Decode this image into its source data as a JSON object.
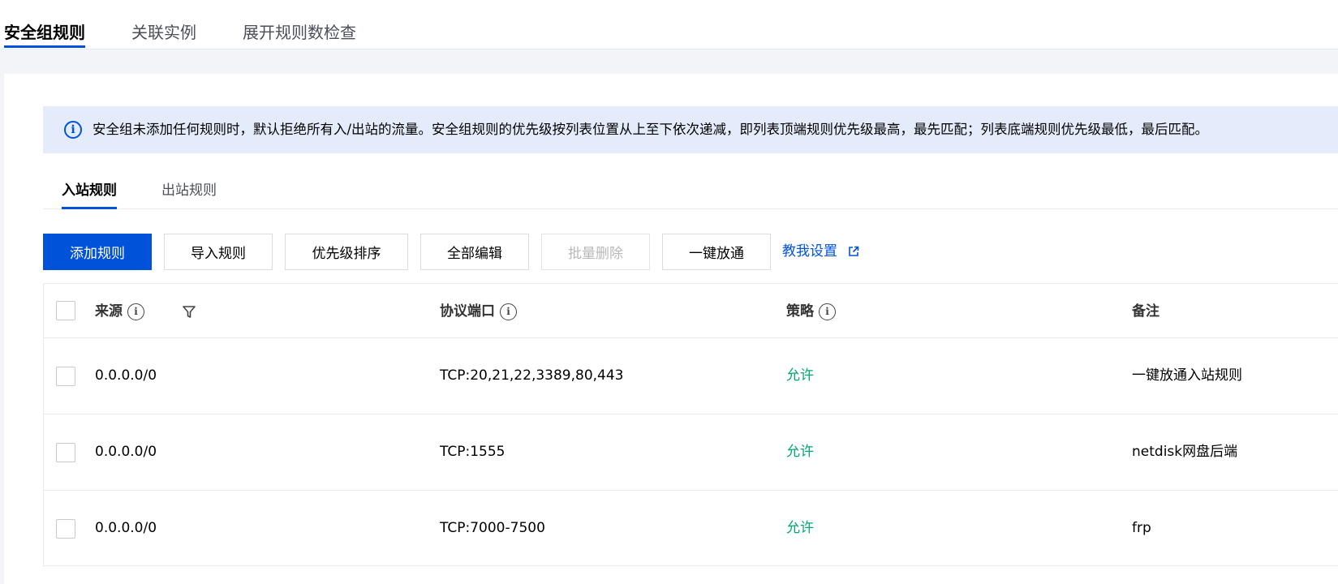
{
  "top_tabs": [
    {
      "label": "安全组规则",
      "active": true
    },
    {
      "label": "关联实例",
      "active": false
    },
    {
      "label": "展开规则数检查",
      "active": false
    }
  ],
  "banner": {
    "icon": "info-icon",
    "text": "安全组未添加任何规则时，默认拒绝所有入/出站的流量。安全组规则的优先级按列表位置从上至下依次递减，即列表顶端规则优先级最高，最先匹配；列表底端规则优先级最低，最后匹配。"
  },
  "sub_tabs": [
    {
      "label": "入站规则",
      "active": true
    },
    {
      "label": "出站规则",
      "active": false
    }
  ],
  "toolbar": {
    "add_rule": "添加规则",
    "import_rule": "导入规则",
    "priority_sort": "优先级排序",
    "edit_all": "全部编辑",
    "batch_delete": "批量删除",
    "one_click_open": "一键放通",
    "help_link": "教我设置"
  },
  "table": {
    "headers": {
      "source": "来源",
      "protocol_port": "协议端口",
      "policy": "策略",
      "remark": "备注"
    },
    "rows": [
      {
        "source": "0.0.0.0/0",
        "protocol_port": "TCP:20,21,22,3389,80,443",
        "policy": "允许",
        "remark": "一键放通入站规则"
      },
      {
        "source": "0.0.0.0/0",
        "protocol_port": "TCP:1555",
        "policy": "允许",
        "remark": "netdisk网盘后端"
      },
      {
        "source": "0.0.0.0/0",
        "protocol_port": "TCP:7000-7500",
        "policy": "允许",
        "remark": "frp"
      }
    ]
  },
  "colors": {
    "accent": "#0052d9",
    "allow": "#00a870",
    "banner_bg": "#e4ecfc"
  }
}
